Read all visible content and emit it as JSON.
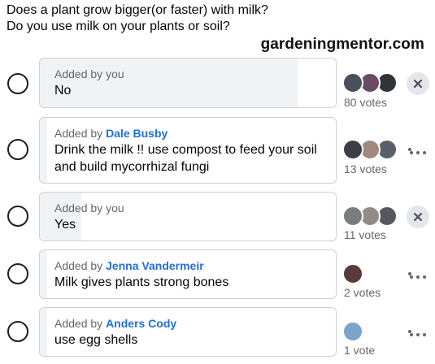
{
  "question": {
    "line1": "Does a plant grow bigger(or faster) with milk?",
    "line2": "Do you use milk on your plants or soil?"
  },
  "watermark": "gardeningmentor.com",
  "options": [
    {
      "added_prefix": "Added by ",
      "added_by": "you",
      "added_by_is_link": false,
      "text": "No",
      "votes": "80 votes",
      "vote_share": 0.872,
      "action": "remove-icon",
      "avatar_colors": [
        "#4a4f5c",
        "#6b4a66",
        "#2f3438"
      ]
    },
    {
      "added_prefix": "Added by ",
      "added_by": "Dale Busby",
      "added_by_is_link": true,
      "text": "Drink the milk !! use compost to feed your soil and build mycorrhizal fungi",
      "votes": "13 votes",
      "vote_share": 0.0,
      "action": "more-icon",
      "avatar_colors": [
        "#3b3f45",
        "#a08a80",
        "#58606a"
      ]
    },
    {
      "added_prefix": "Added by ",
      "added_by": "you",
      "added_by_is_link": false,
      "text": "Yes",
      "votes": "11 votes",
      "vote_share": 0.14,
      "action": "remove-icon",
      "avatar_colors": [
        "#7a7d80",
        "#8f8c85",
        "#55595e"
      ]
    },
    {
      "added_prefix": "Added by ",
      "added_by": "Jenna Vandermeir",
      "added_by_is_link": true,
      "text": "Milk gives plants strong bones",
      "votes": "2 votes",
      "vote_share": 0.025,
      "action": "more-icon",
      "avatar_colors": [
        "#5a3a3a"
      ]
    },
    {
      "added_prefix": "Added by ",
      "added_by": "Anders Cody",
      "added_by_is_link": true,
      "text": "use egg shells",
      "votes": "1 vote",
      "vote_share": 0.015,
      "action": "more-icon",
      "avatar_colors": [
        "#7ea3c8"
      ]
    }
  ],
  "colors": {
    "link": "#216fdb",
    "bar_fill": "#f0f2f5",
    "muted": "#65676b"
  }
}
